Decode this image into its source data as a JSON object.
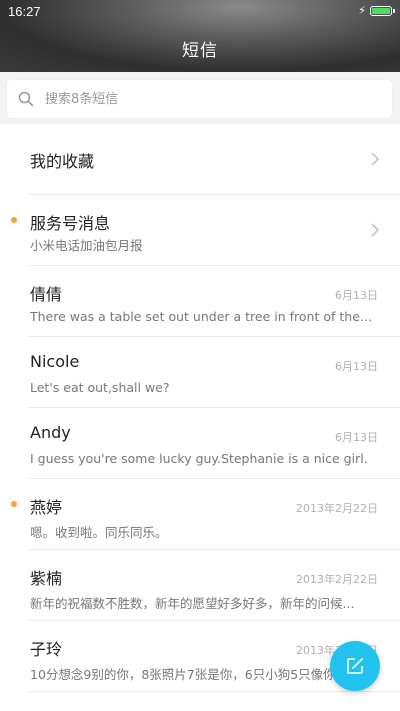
{
  "status_bar": {
    "time": "16:27",
    "battery_level": 1.0,
    "battery_color": "#4cd964"
  },
  "header": {
    "title": "短信"
  },
  "search": {
    "placeholder": "搜索8条短信"
  },
  "favorites": {
    "label": "我的收藏"
  },
  "conversations": [
    {
      "name": "服务号消息",
      "preview": "小米电话加油包月报",
      "date": "",
      "unread": true,
      "has_chevron": true
    },
    {
      "name": "倩倩",
      "preview": "There was a table set out under a tree in front of the ho...",
      "date": "6月13日",
      "unread": false,
      "has_chevron": false
    },
    {
      "name": "Nicole",
      "preview": "Let's eat out,shall we?",
      "date": "6月13日",
      "unread": false,
      "has_chevron": false
    },
    {
      "name": "Andy",
      "preview": "I guess you're some lucky guy.Stephanie is a nice girl.",
      "date": "6月13日",
      "unread": false,
      "has_chevron": false
    },
    {
      "name": "燕婷",
      "preview": "嗯。收到啦。同乐同乐。",
      "date": "2013年2月22日",
      "unread": true,
      "has_chevron": false
    },
    {
      "name": "紫楠",
      "preview": "新年的祝福数不胜数，新年的愿望好多好多，新年的问候...",
      "date": "2013年2月22日",
      "unread": false,
      "has_chevron": false
    },
    {
      "name": "子玲",
      "preview": "10分想念9别的你，8张照片7张是你，6只小狗5只像你...",
      "date": "2013年2月22日",
      "unread": false,
      "has_chevron": false
    }
  ],
  "colors": {
    "accent": "#22c3ee",
    "unread_dot": "#f0a630"
  },
  "icons": {
    "search": "search-icon",
    "compose": "compose-icon",
    "chevron": "chevron-right-icon"
  }
}
